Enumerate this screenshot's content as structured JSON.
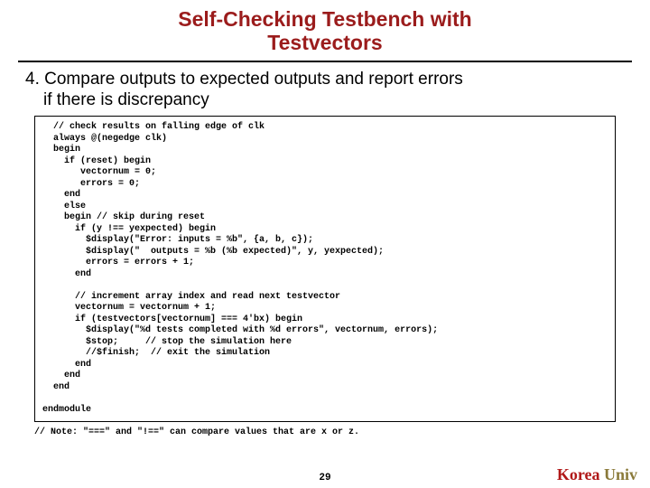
{
  "slide": {
    "title_line1": "Self-Checking Testbench with",
    "title_line2": "Testvectors",
    "step_number": "4.",
    "step_text_line1": "Compare outputs to expected outputs and report errors",
    "step_text_line2": "if there is discrepancy",
    "code": "  // check results on falling edge of clk\n  always @(negedge clk)\n  begin\n    if (reset) begin\n       vectornum = 0;\n       errors = 0;\n    end\n    else\n    begin // skip during reset\n      if (y !== yexpected) begin\n        $display(\"Error: inputs = %b\", {a, b, c});\n        $display(\"  outputs = %b (%b expected)\", y, yexpected);\n        errors = errors + 1;\n      end\n\n      // increment array index and read next testvector\n      vectornum = vectornum + 1;\n      if (testvectors[vectornum] === 4'bx) begin\n        $display(\"%d tests completed with %d errors\", vectornum, errors);\n        $stop;     // stop the simulation here\n        //$finish;  // exit the simulation\n      end\n    end\n  end\n\nendmodule",
    "note": "// Note: \"===\" and \"!==\" can compare values that are x or z.",
    "page_number": "29",
    "logo_text_1": "Korea",
    "logo_text_2": "Univ"
  }
}
